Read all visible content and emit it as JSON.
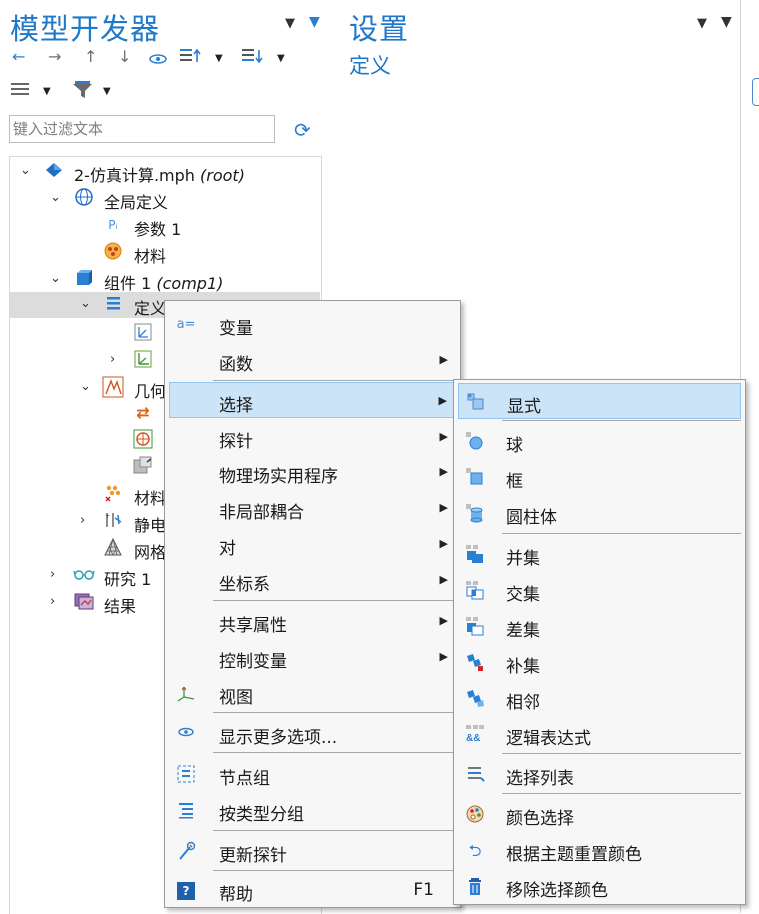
{
  "model_builder": {
    "title": "模型开发器",
    "toolbar": {
      "back": "←",
      "forward": "→",
      "up": "↑",
      "down": "↓"
    },
    "filter_placeholder": "键入过滤文本",
    "tree": [
      {
        "label": "2-仿真计算.mph",
        "suffix": "(root)"
      },
      {
        "label": "全局定义",
        "suffix": ""
      },
      {
        "label": "参数 1",
        "suffix": ""
      },
      {
        "label": "材料",
        "suffix": ""
      },
      {
        "label": "组件 1",
        "suffix": "(comp1)"
      },
      {
        "label": "定义",
        "suffix": ""
      },
      {
        "label": "",
        "suffix": ""
      },
      {
        "label": "",
        "suffix": ""
      },
      {
        "label": "几何",
        "suffix": ""
      },
      {
        "label": "",
        "suffix": ""
      },
      {
        "label": "",
        "suffix": ""
      },
      {
        "label": "",
        "suffix": ""
      },
      {
        "label": "材料",
        "suffix": ""
      },
      {
        "label": "静电",
        "suffix": ""
      },
      {
        "label": "网格",
        "suffix": ""
      },
      {
        "label": "研究 1",
        "suffix": ""
      },
      {
        "label": "结果",
        "suffix": ""
      }
    ]
  },
  "settings": {
    "title": "设置",
    "subtitle": "定义"
  },
  "context_menu": {
    "items": [
      "变量",
      "函数",
      "选择",
      "探针",
      "物理场实用程序",
      "非局部耦合",
      "对",
      "坐标系",
      "共享属性",
      "控制变量",
      "视图",
      "显示更多选项...",
      "节点组",
      "按类型分组",
      "更新探针",
      "帮助"
    ],
    "help_shortcut": "F1"
  },
  "selection_submenu": {
    "items": [
      "显式",
      "球",
      "框",
      "圆柱体",
      "并集",
      "交集",
      "差集",
      "补集",
      "相邻",
      "逻辑表达式",
      "选择列表",
      "颜色选择",
      "根据主题重置颜色",
      "移除选择颜色"
    ]
  },
  "colors": {
    "title_blue": "#1f78c8",
    "accent_blue": "#2a7fd4",
    "highlight": "#cce4f7",
    "selected_row": "#dcdcdc",
    "menu_bg": "#f7f7f7"
  }
}
